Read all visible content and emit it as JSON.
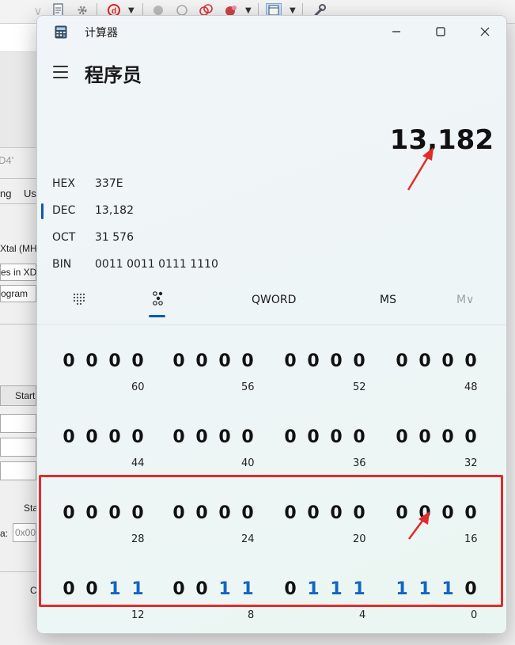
{
  "window": {
    "title": "计算器"
  },
  "header": {
    "mode_title": "程序员"
  },
  "display": {
    "value": "13,182"
  },
  "radix": [
    {
      "label": "HEX",
      "value": "337E",
      "selected": false
    },
    {
      "label": "DEC",
      "value": "13,182",
      "selected": true
    },
    {
      "label": "OCT",
      "value": "31 576",
      "selected": false
    },
    {
      "label": "BIN",
      "value": "0011 0011 0111 1110",
      "selected": false
    }
  ],
  "tabs": {
    "keypad_icon": "keypad-icon",
    "bitflip_icon": "bit-toggle-icon",
    "word_size": "QWORD",
    "memory_store": "MS",
    "memory_menu": "M∨"
  },
  "bits": [
    {
      "row": 0,
      "groups": [
        {
          "bits": [
            "0",
            "0",
            "0",
            "0"
          ],
          "on": [
            false,
            false,
            false,
            false
          ],
          "pos": "60"
        },
        {
          "bits": [
            "0",
            "0",
            "0",
            "0"
          ],
          "on": [
            false,
            false,
            false,
            false
          ],
          "pos": "56"
        },
        {
          "bits": [
            "0",
            "0",
            "0",
            "0"
          ],
          "on": [
            false,
            false,
            false,
            false
          ],
          "pos": "52"
        },
        {
          "bits": [
            "0",
            "0",
            "0",
            "0"
          ],
          "on": [
            false,
            false,
            false,
            false
          ],
          "pos": "48"
        }
      ]
    },
    {
      "row": 1,
      "groups": [
        {
          "bits": [
            "0",
            "0",
            "0",
            "0"
          ],
          "on": [
            false,
            false,
            false,
            false
          ],
          "pos": "44"
        },
        {
          "bits": [
            "0",
            "0",
            "0",
            "0"
          ],
          "on": [
            false,
            false,
            false,
            false
          ],
          "pos": "40"
        },
        {
          "bits": [
            "0",
            "0",
            "0",
            "0"
          ],
          "on": [
            false,
            false,
            false,
            false
          ],
          "pos": "36"
        },
        {
          "bits": [
            "0",
            "0",
            "0",
            "0"
          ],
          "on": [
            false,
            false,
            false,
            false
          ],
          "pos": "32"
        }
      ]
    },
    {
      "row": 2,
      "groups": [
        {
          "bits": [
            "0",
            "0",
            "0",
            "0"
          ],
          "on": [
            false,
            false,
            false,
            false
          ],
          "pos": "28"
        },
        {
          "bits": [
            "0",
            "0",
            "0",
            "0"
          ],
          "on": [
            false,
            false,
            false,
            false
          ],
          "pos": "24"
        },
        {
          "bits": [
            "0",
            "0",
            "0",
            "0"
          ],
          "on": [
            false,
            false,
            false,
            false
          ],
          "pos": "20"
        },
        {
          "bits": [
            "0",
            "0",
            "0",
            "0"
          ],
          "on": [
            false,
            false,
            false,
            false
          ],
          "pos": "16"
        }
      ]
    },
    {
      "row": 3,
      "groups": [
        {
          "bits": [
            "0",
            "0",
            "1",
            "1"
          ],
          "on": [
            false,
            false,
            true,
            true
          ],
          "pos": "12"
        },
        {
          "bits": [
            "0",
            "0",
            "1",
            "1"
          ],
          "on": [
            false,
            false,
            true,
            true
          ],
          "pos": "8"
        },
        {
          "bits": [
            "0",
            "1",
            "1",
            "1"
          ],
          "on": [
            false,
            true,
            true,
            true
          ],
          "pos": "4"
        },
        {
          "bits": [
            "1",
            "1",
            "1",
            "0"
          ],
          "on": [
            true,
            true,
            true,
            false
          ],
          "pos": "0"
        }
      ]
    }
  ],
  "background_app": {
    "texts": [
      "D4'",
      "ng",
      "Us",
      "Xtal (MH",
      "es in XD",
      "ogram",
      "Start",
      "Sta",
      "a:",
      "0x00",
      "C"
    ]
  },
  "colors": {
    "accent": "#0b5aa8",
    "bit_on": "#1565c0",
    "annotation": "#e32b2b"
  }
}
